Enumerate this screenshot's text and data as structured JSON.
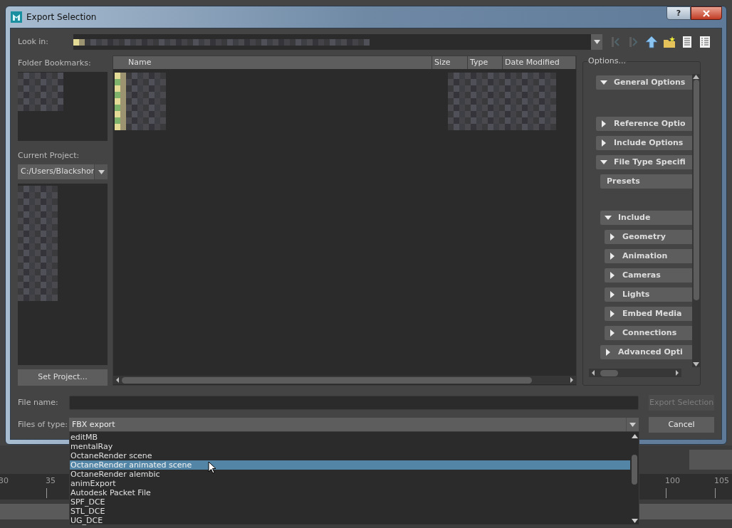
{
  "window": {
    "title": "Export Selection",
    "help": "?"
  },
  "look_in": {
    "label": "Look in:"
  },
  "nav_buttons": [
    {
      "kind": "back",
      "disabled": true
    },
    {
      "kind": "forward",
      "disabled": true
    },
    {
      "kind": "up",
      "disabled": false
    },
    {
      "kind": "new_folder",
      "disabled": false
    },
    {
      "kind": "list_view",
      "disabled": false
    },
    {
      "kind": "detail_view",
      "disabled": false
    }
  ],
  "bookmarks": {
    "label": "Folder Bookmarks:"
  },
  "project": {
    "label": "Current Project:",
    "value": "C:/Users/Blackshor",
    "button": "Set Project..."
  },
  "file_list": {
    "columns": [
      "Name",
      "Size",
      "Type",
      "Date Modified"
    ]
  },
  "options": {
    "title": "Options...",
    "sections": [
      {
        "kind": "section",
        "label": "General Options",
        "expanded": true
      },
      {
        "kind": "section",
        "label": "Reference Optio",
        "expanded": false
      },
      {
        "kind": "section",
        "label": "Include Options",
        "expanded": false
      },
      {
        "kind": "section",
        "label": "File Type Specifi",
        "expanded": true,
        "children": [
          {
            "kind": "button",
            "label": "Presets"
          },
          {
            "kind": "section",
            "label": "Include",
            "expanded": true,
            "children": [
              {
                "kind": "section",
                "label": "Geometry",
                "expanded": false
              },
              {
                "kind": "section",
                "label": "Animation",
                "expanded": false
              },
              {
                "kind": "section",
                "label": "Cameras",
                "expanded": false
              },
              {
                "kind": "section",
                "label": "Lights",
                "expanded": false
              },
              {
                "kind": "section",
                "label": "Embed Media",
                "expanded": false
              },
              {
                "kind": "section",
                "label": "Connections",
                "expanded": false
              }
            ]
          },
          {
            "kind": "section",
            "label": "Advanced Opti",
            "expanded": false
          }
        ]
      }
    ]
  },
  "file_name": {
    "label": "File name:"
  },
  "file_type": {
    "label": "Files of type:",
    "value": "FBX export",
    "options": [
      {
        "label": "editMB",
        "selected": false
      },
      {
        "label": "mentalRay",
        "selected": false
      },
      {
        "label": "OctaneRender scene",
        "selected": false
      },
      {
        "label": "OctaneRender animated scene",
        "selected": true
      },
      {
        "label": "OctaneRender alembic",
        "selected": false
      },
      {
        "label": "animExport",
        "selected": false
      },
      {
        "label": "Autodesk Packet File",
        "selected": false
      },
      {
        "label": "SPF_DCE",
        "selected": false
      },
      {
        "label": "STL_DCE",
        "selected": false
      },
      {
        "label": "UG_DCE",
        "selected": false
      }
    ]
  },
  "buttons": [
    {
      "label": "Export Selection",
      "disabled": true
    },
    {
      "label": "Cancel",
      "disabled": false
    }
  ],
  "timeline": {
    "ticks": [
      "30",
      "35",
      "100",
      "105"
    ]
  }
}
